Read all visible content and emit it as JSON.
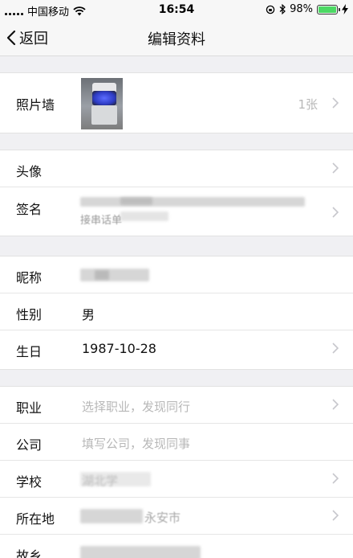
{
  "status_bar": {
    "carrier": "中国移动",
    "time": "16:54",
    "battery": "98%",
    "battery_level": 0.98,
    "icons": [
      "signal-icon",
      "wifi-icon",
      "lock-rotation-icon",
      "bluetooth-icon",
      "battery-icon",
      "charging-icon"
    ]
  },
  "nav": {
    "back_label": "返回",
    "title": "编辑资料"
  },
  "photo_wall": {
    "label": "照片墙",
    "count": "1张"
  },
  "section2": {
    "avatar_label": "头像",
    "signature_label": "签名",
    "signature_visible": "接串话单"
  },
  "section3": {
    "nickname_label": "昵称",
    "gender_label": "性别",
    "gender_value": "男",
    "birthday_label": "生日",
    "birthday_value": "1987-10-28"
  },
  "section4": {
    "job_label": "职业",
    "job_placeholder": "选择职业，发现同行",
    "company_label": "公司",
    "company_placeholder": "填写公司，发现同事",
    "school_label": "学校",
    "school_visible": "湖北学",
    "location_label": "所在地",
    "location_visible": "永安市",
    "hometown_label": "故乡"
  }
}
